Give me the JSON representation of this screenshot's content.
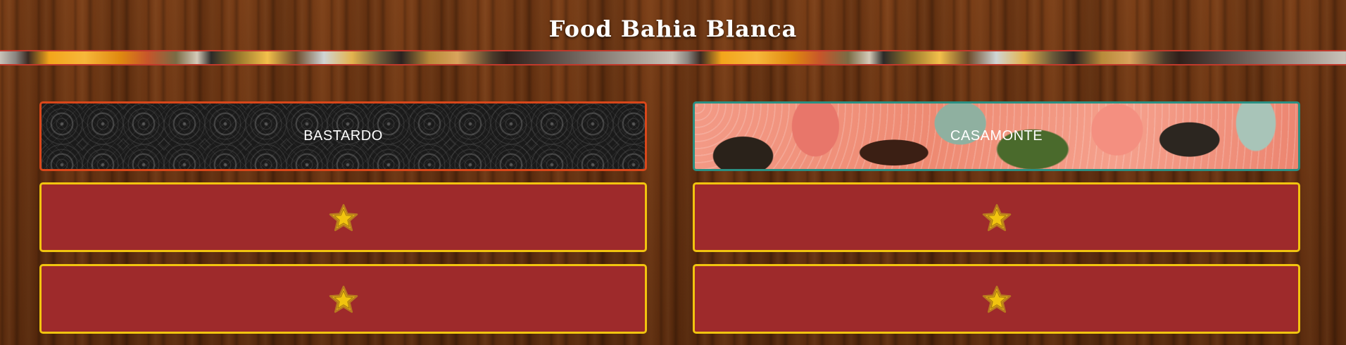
{
  "page": {
    "title": "Food Bahia Blanca"
  },
  "banner": {
    "icon": "food-collage-banner"
  },
  "restaurants": [
    {
      "name": "BASTARDO",
      "border_color": "#d9471a"
    },
    {
      "name": "CASAMONTE",
      "border_color": "#2a8f82"
    }
  ],
  "dishes": [
    {
      "icon": "star-icon",
      "border_color": "#f1c40f",
      "fill_color": "#9e2a2b"
    },
    {
      "icon": "star-icon",
      "border_color": "#f1c40f",
      "fill_color": "#9e2a2b"
    },
    {
      "icon": "star-icon",
      "border_color": "#f1c40f",
      "fill_color": "#9e2a2b"
    },
    {
      "icon": "star-icon",
      "border_color": "#f1c40f",
      "fill_color": "#9e2a2b"
    }
  ],
  "colors": {
    "star_fill": "#f1c40f",
    "star_stroke": "#b7791f",
    "title_text": "#ffffff",
    "wood_background": "#6a3514"
  }
}
